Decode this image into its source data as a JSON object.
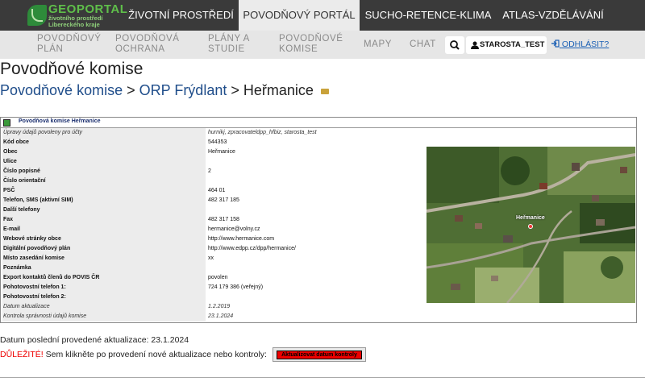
{
  "logo": {
    "name": "GEOPORTAL",
    "sub1": "životního prostředí",
    "sub2": "Libereckého kraje"
  },
  "topnav": [
    "ŽIVOTNÍ PROSTŘEDÍ",
    "POVODŇOVÝ PORTÁL",
    "SUCHO-RETENCE-KLIMA",
    "ATLAS-VZDĚLÁVÁNÍ"
  ],
  "subnav": {
    "povodnovy_plan": [
      "POVODŇOVÝ",
      "PLÁN"
    ],
    "povodnova_ochrana": [
      "POVODŇOVÁ",
      "OCHRANA"
    ],
    "plany_studie": [
      "PLÁNY A",
      "STUDIE"
    ],
    "povodnove_komise": [
      "POVODŇOVÉ",
      "KOMISE"
    ],
    "mapy": "MAPY",
    "chat": "CHAT",
    "user": "STAROSTA_TEST",
    "logout": "ODHLÁSIT?"
  },
  "page_title": "Povodňové komise",
  "breadcrumb": {
    "root": "Povodňové komise",
    "sep": ">",
    "orp": "ORP Frýdlant",
    "current": "Heřmanice"
  },
  "panel_title": "Povodňová komise Heřmanice",
  "rows": [
    {
      "label": "Úpravy údajů povoleny pro účty",
      "value": "hurnikj, zpracovateldpp_hfbiz, starosta_test"
    },
    {
      "label": "Kód obce",
      "value": "544353"
    },
    {
      "label": "Obec",
      "value": "Heřmanice"
    },
    {
      "label": "Ulice",
      "value": ""
    },
    {
      "label": "Číslo popisné",
      "value": "2"
    },
    {
      "label": "Číslo orientační",
      "value": ""
    },
    {
      "label": "PSČ",
      "value": "464 01"
    },
    {
      "label": "Telefon, SMS (aktivní SIM)",
      "value": "482 317 185"
    },
    {
      "label": "Další telefony",
      "value": ""
    },
    {
      "label": "Fax",
      "value": "482 317 158"
    },
    {
      "label": "E-mail",
      "value": "hermanice@volny.cz"
    },
    {
      "label": "Webové stránky obce",
      "value": "http://www.hermanice.com"
    },
    {
      "label": "Digitální povodňový plán",
      "value": "http://www.edpp.cz/dpp/hermanice/"
    },
    {
      "label": "Místo zasedání komise",
      "value": "xx"
    },
    {
      "label": "Poznámka",
      "value": ""
    },
    {
      "label": "Export kontaktů členů do POVIS ČR",
      "value": "povolen"
    },
    {
      "label": "Pohotovostní telefon 1:",
      "value": "724 179 386 (veřejný)"
    },
    {
      "label": "Pohotovostní telefon 2:",
      "value": ""
    },
    {
      "label": "Datum aktualizace",
      "value": "1.2.2019"
    },
    {
      "label": "Kontrola správnosti údajů komise",
      "value": "23.1.2024"
    }
  ],
  "map_label": "Heřmanice",
  "footer": {
    "last_update_label": "Datum poslední provedené aktualizace:",
    "last_update": "23.1.2024",
    "important": "DŮLEŽITÉ!",
    "instruction": "Sem klikněte po provedení nové aktualizace nebo kontroly:",
    "button": "Aktualizovat datum kontroly"
  }
}
